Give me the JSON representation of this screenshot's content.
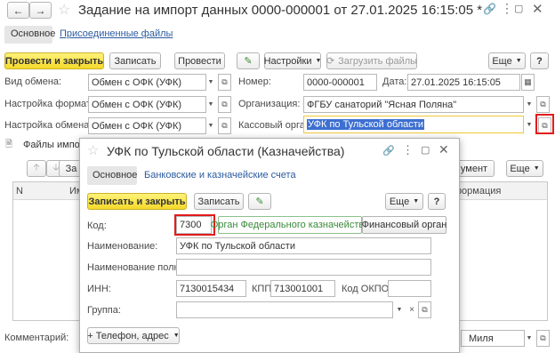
{
  "main": {
    "title": "Задание на импорт данных 0000-000001 от 27.01.2025 16:15:05 *",
    "tabs": [
      "Основное",
      "Присоединенные файлы"
    ],
    "toolbar": {
      "post_close": "Провести и закрыть",
      "save": "Записать",
      "post": "Провести",
      "settings": "Настройки",
      "load_files": "Загрузить файлы",
      "more": "Еще",
      "help": "?"
    },
    "fields": {
      "exchange_type_label": "Вид обмена:",
      "exchange_type_value": "Обмен с ОФК (УФК)",
      "format_settings_label": "Настройка форматов:",
      "format_settings_value": "Обмен с ОФК (УФК)",
      "exchange_settings_label": "Настройка обмена:",
      "exchange_settings_value": "Обмен с ОФК (УФК)",
      "number_label": "Номер:",
      "number_value": "0000-000001",
      "date_label": "Дата:",
      "date_value": "27.01.2025 16:15:05",
      "org_label": "Организация:",
      "org_value": "ФГБУ санаторий \"Ясная Поляна\"",
      "cash_label": "Кассовый орган:",
      "cash_value": "УФК по Тульской области"
    },
    "files_section": "Файлы импорт",
    "files_toolbar": {
      "left_btn_label": "За",
      "document_btn": "умент",
      "more": "Еще"
    },
    "files_table": {
      "col_n": "N",
      "col_name": "Им",
      "col_info": "формация"
    },
    "comment_label": "Комментарий:",
    "responsible_value": "Миля"
  },
  "dialog": {
    "title": "УФК по Тульской области (Казначейства)",
    "tabs": [
      "Основное",
      "Банковские и казначейские счета"
    ],
    "toolbar": {
      "save_close": "Записать и закрыть",
      "save": "Записать",
      "more": "Еще",
      "help": "?"
    },
    "code_label": "Код:",
    "code_value": "7300",
    "type_options": [
      "Орган Федерального казначейства",
      "Финансовый орган"
    ],
    "name_label": "Наименование:",
    "name_value": "УФК по Тульской области",
    "fullname_label": "Наименование полное:",
    "fullname_value": "",
    "inn_label": "ИНН:",
    "inn_value": "7130015434",
    "kpp_label": "КПП:",
    "kpp_value": "713001001",
    "okpo_label": "Код ОКПО:",
    "okpo_value": "",
    "group_label": "Группа:",
    "group_value": "",
    "phone_button": "+ Телефон, адрес"
  },
  "colors": {
    "accent_yellow": "#f5d92a",
    "link_blue": "#2b5ba0",
    "highlight_red": "#e21b1b",
    "selection_blue": "#3d6fd1"
  }
}
